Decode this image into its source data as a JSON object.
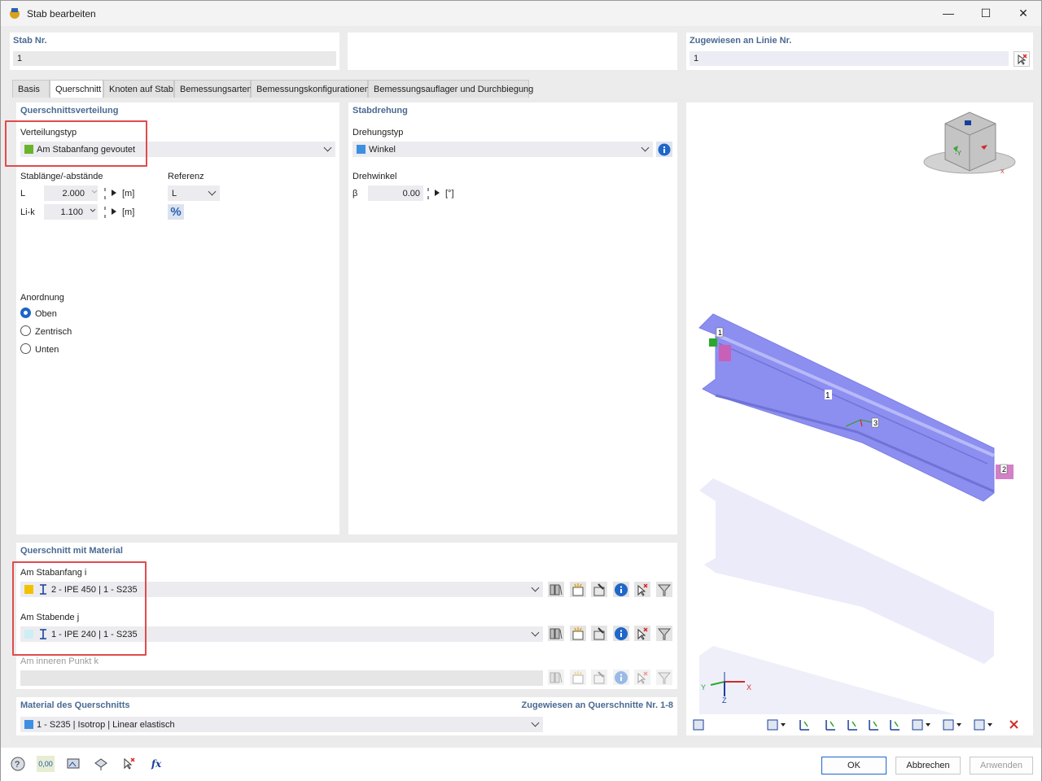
{
  "window": {
    "title": "Stab bearbeiten",
    "minimize": "—",
    "maximize": "☐",
    "close": "✕"
  },
  "header": {
    "stab_nr_label": "Stab Nr.",
    "stab_nr_value": "1",
    "line_label": "Zugewiesen an Linie Nr.",
    "line_value": "1"
  },
  "tabs": [
    "Basis",
    "Querschnitt",
    "Knoten auf Stab",
    "Bemessungsarten",
    "Bemessungskonfigurationen",
    "Bemessungsauflager und Durchbiegung"
  ],
  "distribution": {
    "title": "Querschnittsverteilung",
    "type_label": "Verteilungstyp",
    "type_value": "Am Stabanfang gevoutet",
    "type_color": "#6ab42a",
    "length_label": "Stablänge/-abstände",
    "ref_label": "Referenz",
    "L_label": "L",
    "L_value": "2.000",
    "L_unit": "[m]",
    "Lik_label": "Li-k",
    "Lik_value": "1.100",
    "Lik_unit": "[m]",
    "ref_value": "L",
    "percent": "%",
    "arrangement_label": "Anordnung",
    "options": [
      "Oben",
      "Zentrisch",
      "Unten"
    ],
    "selected": "Oben"
  },
  "rotation": {
    "title": "Stabdrehung",
    "type_label": "Drehungstyp",
    "type_value": "Winkel",
    "type_color": "#3d8fe0",
    "angle_label": "Drehwinkel",
    "beta_label": "β",
    "beta_value": "0.00",
    "beta_unit": "[°]"
  },
  "section": {
    "title": "Querschnitt mit Material",
    "start_label": "Am Stabanfang i",
    "start_value": "2 - IPE 450 | 1 - S235",
    "start_color": "#f2c200",
    "end_label": "Am Stabende j",
    "end_value": "1 - IPE 240 | 1 - S235",
    "end_color": "#cdeef5",
    "inner_label": "Am inneren Punkt k"
  },
  "material": {
    "title": "Material des Querschnitts",
    "assigned": "Zugewiesen an Querschnitte Nr. 1-8",
    "value": "1 - S235 | Isotrop | Linear elastisch",
    "color": "#3d8fe0"
  },
  "view3d": {
    "node1": "1",
    "node2": "2",
    "node3": "3",
    "member": "1",
    "axis_x": "X",
    "axis_y": "Y",
    "axis_z": "Z",
    "cube_neg": "-Y",
    "cube_x": "X"
  },
  "footer": {
    "ok": "OK",
    "cancel": "Abbrechen",
    "apply": "Anwenden",
    "units": "0,00"
  }
}
